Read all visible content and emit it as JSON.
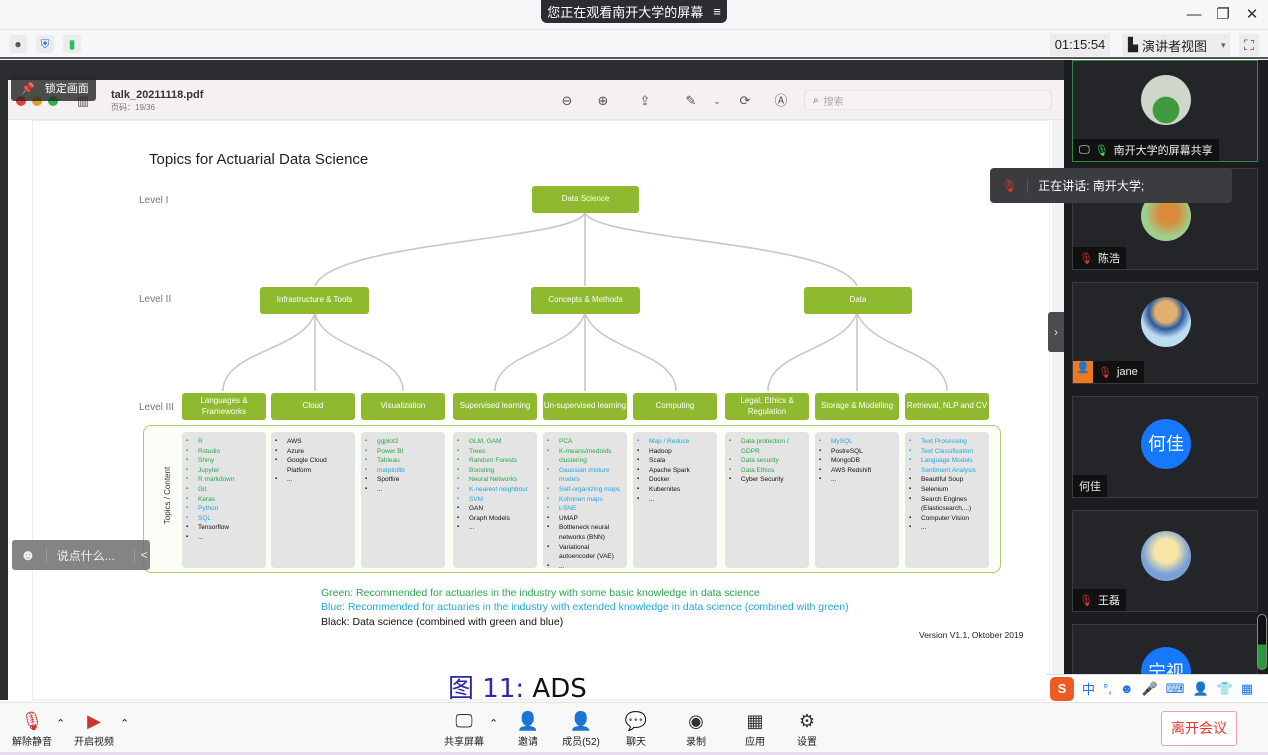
{
  "titlebar": {
    "share_notice": "您正在观看南开大学的屏幕",
    "menu_icon": "≡",
    "minimize": "—",
    "restore": "❐",
    "close": "✕"
  },
  "toolbar": {
    "timer": "01:15:54",
    "view_mode": "演讲者视图",
    "view_mode_caret": "▾",
    "fullscreen_icon": "⛶"
  },
  "pdf": {
    "filename": "talk_20211118.pdf",
    "page": "页码：19/36",
    "lock_label": "锁定画面",
    "search_placeholder": "搜索"
  },
  "slide": {
    "title": "Topics for Actuarial Data Science",
    "levels": [
      "Level I",
      "Level II",
      "Level III"
    ],
    "level1": "Data Science",
    "level2": [
      "Infrastructure & Tools",
      "Concepts & Methods",
      "Data"
    ],
    "level3": [
      "Languages & Frameworks",
      "Cloud",
      "Visualization",
      "Supervised learning",
      "Un-supervised learning",
      "Computing",
      "Legal, Ethics & Regulation",
      "Storage & Modelling",
      "Retrieval, NLP and CV"
    ],
    "topics_label": "Topics / Content",
    "columns": [
      [
        {
          "t": "R",
          "c": "g"
        },
        {
          "t": "Rstudio",
          "c": "g"
        },
        {
          "t": "Shiny",
          "c": "g"
        },
        {
          "t": "Jupyter",
          "c": "g"
        },
        {
          "t": "R markdown",
          "c": "g"
        },
        {
          "t": "Git",
          "c": "g"
        },
        {
          "t": "Keras",
          "c": "g"
        },
        {
          "t": "Python",
          "c": "b"
        },
        {
          "t": "SQL",
          "c": "b"
        },
        {
          "t": "Tensorflow",
          "c": "k"
        },
        {
          "t": "...",
          "c": "k"
        }
      ],
      [
        {
          "t": "AWS",
          "c": "k"
        },
        {
          "t": "Azure",
          "c": "k"
        },
        {
          "t": "Google Cloud Platform",
          "c": "k"
        },
        {
          "t": "...",
          "c": "k"
        }
      ],
      [
        {
          "t": "ggplot2",
          "c": "g"
        },
        {
          "t": "Power BI",
          "c": "g"
        },
        {
          "t": "Tableau",
          "c": "g"
        },
        {
          "t": "matplotlib",
          "c": "b"
        },
        {
          "t": "Spotfire",
          "c": "k"
        },
        {
          "t": "...",
          "c": "k"
        }
      ],
      [
        {
          "t": "GLM, GAM",
          "c": "g"
        },
        {
          "t": "Trees",
          "c": "g"
        },
        {
          "t": "Random Forests",
          "c": "g"
        },
        {
          "t": "Boosting",
          "c": "g"
        },
        {
          "t": "Neural Networks",
          "c": "g"
        },
        {
          "t": "K-nearest neighbour",
          "c": "b"
        },
        {
          "t": "SVM",
          "c": "b"
        },
        {
          "t": "GAN",
          "c": "k"
        },
        {
          "t": "Graph Models",
          "c": "k"
        },
        {
          "t": "...",
          "c": "k"
        }
      ],
      [
        {
          "t": "PCA",
          "c": "g"
        },
        {
          "t": "K-means/medoids clustering",
          "c": "g"
        },
        {
          "t": "Gaussian mixture models",
          "c": "b"
        },
        {
          "t": "Self-organizing maps",
          "c": "b"
        },
        {
          "t": "Kohonen maps",
          "c": "b"
        },
        {
          "t": "t-SNE",
          "c": "b"
        },
        {
          "t": "UMAP",
          "c": "k"
        },
        {
          "t": "Bottleneck neural networks (BNN)",
          "c": "k"
        },
        {
          "t": "Variational autoencoder (VAE)",
          "c": "k"
        },
        {
          "t": "...",
          "c": "k"
        }
      ],
      [
        {
          "t": "Map / Reduce",
          "c": "b"
        },
        {
          "t": "Hadoop",
          "c": "k"
        },
        {
          "t": "Scala",
          "c": "k"
        },
        {
          "t": "Apache Spark",
          "c": "k"
        },
        {
          "t": "Docker",
          "c": "k"
        },
        {
          "t": "Kubernites",
          "c": "k"
        },
        {
          "t": "...",
          "c": "k"
        }
      ],
      [
        {
          "t": "Data protection / GDPR",
          "c": "g"
        },
        {
          "t": "Data security",
          "c": "g"
        },
        {
          "t": "Data Ethics",
          "c": "g"
        },
        {
          "t": "Cyber Security",
          "c": "k"
        }
      ],
      [
        {
          "t": "MySQL",
          "c": "b"
        },
        {
          "t": "PostreSQL",
          "c": "k"
        },
        {
          "t": "MongoDB",
          "c": "k"
        },
        {
          "t": "AWS Redshift",
          "c": "k"
        },
        {
          "t": "...",
          "c": "k"
        }
      ],
      [
        {
          "t": "Text Processing",
          "c": "b"
        },
        {
          "t": "Text Classification",
          "c": "b"
        },
        {
          "t": "Language Models",
          "c": "b"
        },
        {
          "t": "Sentiment Analysis",
          "c": "b"
        },
        {
          "t": "Beautiful Soup",
          "c": "k"
        },
        {
          "t": "Selenium",
          "c": "k"
        },
        {
          "t": "Search Engines (Elasticsearch,...)",
          "c": "k"
        },
        {
          "t": "Computer Vision",
          "c": "k"
        },
        {
          "t": "...",
          "c": "k"
        }
      ]
    ],
    "legend_green": "Green: Recommended for actuaries in the industry with some basic knowledge in data science",
    "legend_blue": "Blue: Recommended for actuaries in the industry with extended knowledge in data science (combined with green)",
    "legend_black": "Black: Data science (combined with green and blue)",
    "version": "Version V1.1, Oktober 2019",
    "colors": {
      "box": "#8fba2f",
      "green": "#2aa84a",
      "blue": "#23a7e0",
      "black": "#111111"
    }
  },
  "caption": {
    "prefix": "图",
    "number": "11",
    "sep": ":",
    "text": "ADS"
  },
  "chat": {
    "placeholder": "说点什么...",
    "collapse": "<"
  },
  "speaking": "正在讲话: 南开大学;",
  "participants": [
    {
      "name": "南开大学的屏幕共享",
      "mic": "on",
      "sharing": true
    },
    {
      "name": "陈浩",
      "mic": "muted"
    },
    {
      "name": "jane",
      "mic": "muted",
      "host_badge": true
    },
    {
      "name": "何佳",
      "mic": "none",
      "avatar_text": "何佳"
    },
    {
      "name": "王磊",
      "mic": "muted"
    },
    {
      "name": "",
      "avatar_text": "宁视"
    }
  ],
  "ime": [
    "中",
    "°,",
    "☻",
    "🎤",
    "⌨",
    "👤",
    "👕",
    "▦"
  ],
  "bottombar": {
    "unmute": "解除静音",
    "start_video": "开启视频",
    "share": "共享屏幕",
    "invite": "邀请",
    "members": "成员(52)",
    "chat": "聊天",
    "record": "录制",
    "apps": "应用",
    "settings": "设置",
    "leave": "离开会议"
  }
}
